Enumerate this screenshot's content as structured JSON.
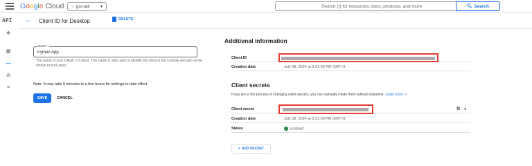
{
  "topbar": {
    "logo_google_parts": [
      "G",
      "o",
      "o",
      "g",
      "l",
      "e"
    ],
    "logo_cloud": "Cloud",
    "project": "gsc-api",
    "search_placeholder": "Search (/) for resources, docs, products, and more",
    "search_button": "Search"
  },
  "rail": {
    "api_label": "API",
    "icons": [
      "api-dashboard-icon",
      "library-icon",
      "credentials-icon",
      "consent-icon",
      "settings-icon"
    ]
  },
  "header": {
    "title": "Client ID for Desktop",
    "delete_label": "DELETE"
  },
  "form": {
    "name_label": "Name *",
    "name_value": "Python App",
    "help_text": "The name of your OAuth 2.0 client. This name is only used to identify the client in the console and will not be shown to end users.",
    "note": "Note: It may take 5 minutes to a few hours for settings to take effect",
    "save_label": "SAVE",
    "cancel_label": "CANCEL"
  },
  "additional_info": {
    "title": "Additional information",
    "client_id_label": "Client ID",
    "creation_date_label": "Creation date",
    "creation_date_value": "July 28, 2024 at 5:51:00 PM GMT+9"
  },
  "client_secrets": {
    "title": "Client secrets",
    "description": "If you are in the process of changing client secrets, you can manually rotate them without downtime.",
    "learn_more": "Learn more",
    "client_secret_label": "Client secret",
    "creation_date_label": "Creation date",
    "creation_date_value": "July 28, 2024 at 5:51:00 PM GMT+9",
    "status_label": "Status",
    "status_value": "Enabled",
    "add_secret_label": "ADD SECRET"
  },
  "colors": {
    "accent": "#1a73e8",
    "highlight_box": "#e53935",
    "status_enabled": "#188038"
  }
}
